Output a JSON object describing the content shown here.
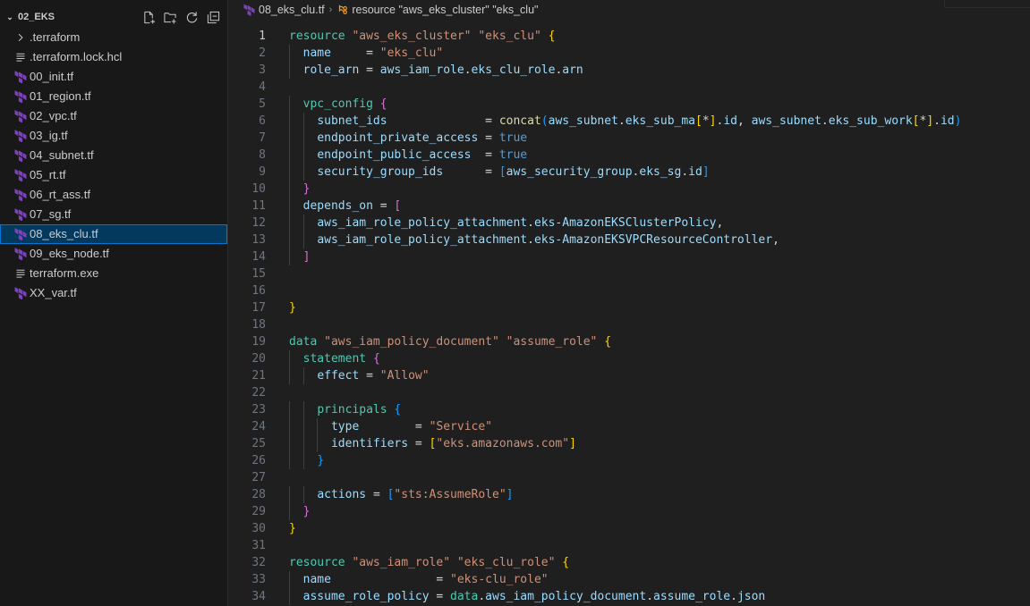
{
  "explorer": {
    "folder_name": "02_EKS",
    "items": [
      {
        "label": ".terraform",
        "type": "folder"
      },
      {
        "label": ".terraform.lock.hcl",
        "type": "file-lines"
      },
      {
        "label": "00_init.tf",
        "type": "terraform"
      },
      {
        "label": "01_region.tf",
        "type": "terraform"
      },
      {
        "label": "02_vpc.tf",
        "type": "terraform"
      },
      {
        "label": "03_ig.tf",
        "type": "terraform"
      },
      {
        "label": "04_subnet.tf",
        "type": "terraform"
      },
      {
        "label": "05_rt.tf",
        "type": "terraform"
      },
      {
        "label": "06_rt_ass.tf",
        "type": "terraform"
      },
      {
        "label": "07_sg.tf",
        "type": "terraform"
      },
      {
        "label": "08_eks_clu.tf",
        "type": "terraform",
        "selected": true
      },
      {
        "label": "09_eks_node.tf",
        "type": "terraform"
      },
      {
        "label": "terraform.exe",
        "type": "file-lines"
      },
      {
        "label": "XX_var.tf",
        "type": "terraform"
      }
    ],
    "actions": [
      "new-file-icon",
      "new-folder-icon",
      "refresh-icon",
      "collapse-all-icon"
    ]
  },
  "breadcrumb": {
    "file": "08_eks_clu.tf",
    "symbol": "resource \"aws_eks_cluster\" \"eks_clu\""
  },
  "editor": {
    "active_line": 1,
    "lines": [
      {
        "n": "1",
        "text": "resource \"aws_eks_cluster\" \"eks_clu\" {"
      },
      {
        "n": "2",
        "text": "  name     = \"eks_clu\""
      },
      {
        "n": "3",
        "text": "  role_arn = aws_iam_role.eks_clu_role.arn"
      },
      {
        "n": "4",
        "text": ""
      },
      {
        "n": "5",
        "text": "  vpc_config {"
      },
      {
        "n": "6",
        "text": "    subnet_ids              = concat(aws_subnet.eks_sub_ma[*].id, aws_subnet.eks_sub_work[*].id)"
      },
      {
        "n": "7",
        "text": "    endpoint_private_access = true"
      },
      {
        "n": "8",
        "text": "    endpoint_public_access  = true"
      },
      {
        "n": "9",
        "text": "    security_group_ids      = [aws_security_group.eks_sg.id]"
      },
      {
        "n": "10",
        "text": "  }"
      },
      {
        "n": "11",
        "text": "  depends_on = ["
      },
      {
        "n": "12",
        "text": "    aws_iam_role_policy_attachment.eks-AmazonEKSClusterPolicy,"
      },
      {
        "n": "13",
        "text": "    aws_iam_role_policy_attachment.eks-AmazonEKSVPCResourceController,"
      },
      {
        "n": "14",
        "text": "  ]"
      },
      {
        "n": "15",
        "text": ""
      },
      {
        "n": "16",
        "text": ""
      },
      {
        "n": "17",
        "text": "}"
      },
      {
        "n": "18",
        "text": ""
      },
      {
        "n": "19",
        "text": "data \"aws_iam_policy_document\" \"assume_role\" {"
      },
      {
        "n": "20",
        "text": "  statement {"
      },
      {
        "n": "21",
        "text": "    effect = \"Allow\""
      },
      {
        "n": "22",
        "text": ""
      },
      {
        "n": "23",
        "text": "    principals {"
      },
      {
        "n": "24",
        "text": "      type        = \"Service\""
      },
      {
        "n": "25",
        "text": "      identifiers = [\"eks.amazonaws.com\"]"
      },
      {
        "n": "26",
        "text": "    }"
      },
      {
        "n": "27",
        "text": ""
      },
      {
        "n": "28",
        "text": "    actions = [\"sts:AssumeRole\"]"
      },
      {
        "n": "29",
        "text": "  }"
      },
      {
        "n": "30",
        "text": "}"
      },
      {
        "n": "31",
        "text": ""
      },
      {
        "n": "32",
        "text": "resource \"aws_iam_role\" \"eks_clu_role\" {"
      },
      {
        "n": "33",
        "text": "  name               = \"eks-clu_role\""
      },
      {
        "n": "34",
        "text": "  assume_role_policy = data.aws_iam_policy_document.assume_role.json"
      }
    ]
  }
}
